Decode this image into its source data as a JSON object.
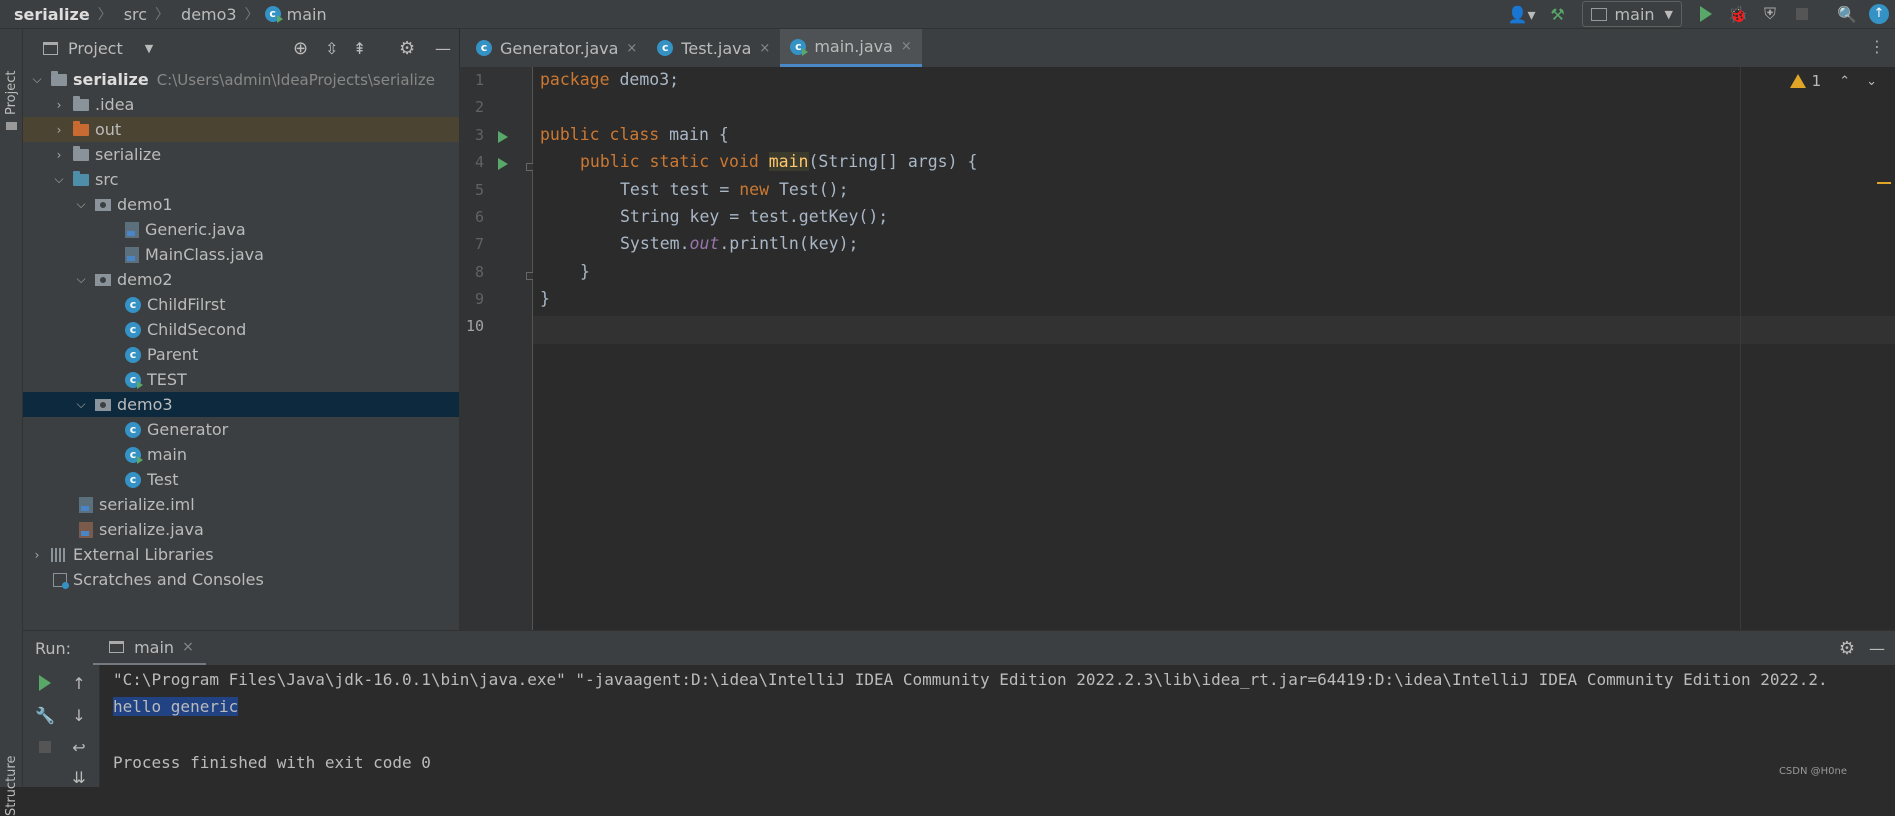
{
  "breadcrumb": {
    "project": "serialize",
    "dir": "src",
    "package": "demo3",
    "file": "main"
  },
  "toolbar": {
    "run_config": "main",
    "icons": [
      "user-icon",
      "build-hammer-icon",
      "run-icon",
      "debug-icon",
      "coverage-icon",
      "stop-icon",
      "search-icon",
      "update-icon"
    ]
  },
  "sidebar": {
    "project_tab": "Project",
    "structure_tab": "Structure"
  },
  "project_panel": {
    "title": "Project",
    "tree": [
      {
        "label": "serialize",
        "path": "C:\\Users\\admin\\IdeaProjects\\serialize"
      },
      {
        "label": ".idea"
      },
      {
        "label": "out"
      },
      {
        "label": "serialize"
      },
      {
        "label": "src"
      },
      {
        "label": "demo1"
      },
      {
        "label": "Generic.java"
      },
      {
        "label": "MainClass.java"
      },
      {
        "label": "demo2"
      },
      {
        "label": "ChildFilrst"
      },
      {
        "label": "ChildSecond"
      },
      {
        "label": "Parent"
      },
      {
        "label": "TEST"
      },
      {
        "label": "demo3"
      },
      {
        "label": "Generator"
      },
      {
        "label": "main"
      },
      {
        "label": "Test"
      },
      {
        "label": "serialize.iml"
      },
      {
        "label": "serialize.java"
      },
      {
        "label": "External Libraries"
      },
      {
        "label": "Scratches and Consoles"
      }
    ]
  },
  "editor_tabs": [
    {
      "label": "Generator.java",
      "close": "×"
    },
    {
      "label": "Test.java",
      "close": "×"
    },
    {
      "label": "main.java",
      "close": "×"
    }
  ],
  "editor": {
    "line_numbers": [
      "1",
      "2",
      "3",
      "4",
      "5",
      "6",
      "7",
      "8",
      "9",
      "10"
    ],
    "warnings": "1",
    "code": {
      "l1_kw": "package",
      "l1_rest": " demo3;",
      "l3_kw": "public class",
      "l3_rest": " main {",
      "l4_kw": "public static void",
      "l4_fn": "main",
      "l4_rest": "(String[] args) {",
      "l5_a": "Test test = ",
      "l5_kw": "new",
      "l5_b": " Test();",
      "l6": "String key = test.getKey();",
      "l7_a": "System.",
      "l7_static": "out",
      "l7_b": ".println(key);",
      "l8": "}",
      "l9": "}"
    }
  },
  "run_panel": {
    "label": "Run:",
    "tab": "main",
    "tab_close": "×",
    "console": [
      "\"C:\\Program Files\\Java\\jdk-16.0.1\\bin\\java.exe\" \"-javaagent:D:\\idea\\IntelliJ IDEA Community Edition 2022.2.3\\lib\\idea_rt.jar=64419:D:\\idea\\IntelliJ IDEA Community Edition 2022.2.",
      "hello generic",
      "",
      "Process finished with exit code 0"
    ]
  },
  "watermark": "CSDN @H0ne"
}
